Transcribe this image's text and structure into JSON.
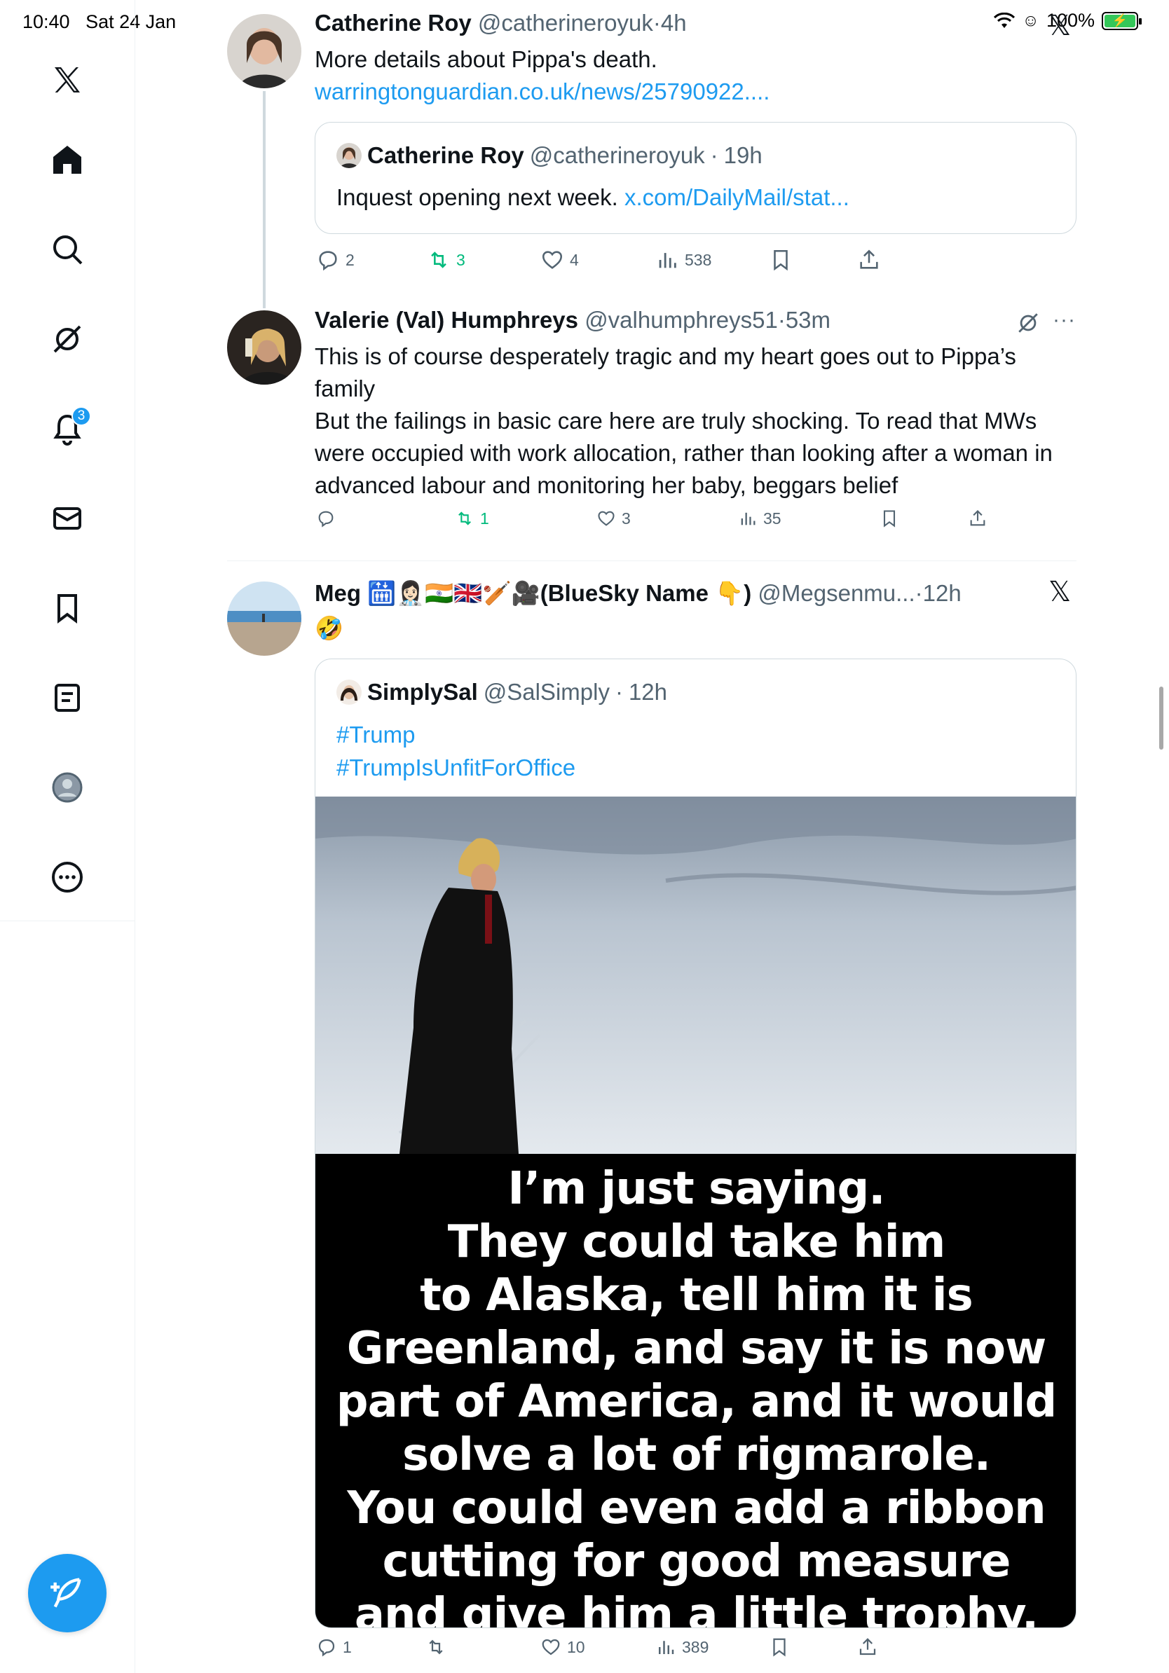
{
  "status_bar": {
    "time": "10:40",
    "date": "Sat 24 Jan",
    "battery": "100%"
  },
  "sidebar": {
    "items": [
      {
        "name": "home",
        "icon": "home-icon"
      },
      {
        "name": "explore",
        "icon": "search-icon"
      },
      {
        "name": "grok",
        "icon": "grok-icon"
      },
      {
        "name": "notifications",
        "icon": "bell-icon",
        "badge": "3"
      },
      {
        "name": "messages",
        "icon": "envelope-icon"
      },
      {
        "name": "bookmarks",
        "icon": "bookmark-icon"
      },
      {
        "name": "lists",
        "icon": "list-icon"
      },
      {
        "name": "profile",
        "icon": "profile-icon"
      },
      {
        "name": "more",
        "icon": "more-icon"
      }
    ],
    "compose_icon": "compose-post-icon"
  },
  "posts": [
    {
      "name": "Catherine Roy",
      "handle": "@catherineroyuk",
      "time": "4h",
      "text": "More details about Pippa's death.",
      "link": "warringtonguardian.co.uk/news/25790922....",
      "quote": {
        "name": "Catherine Roy",
        "handle": "@catherineroyuk",
        "time": "19h",
        "text": "Inquest opening next week.",
        "link": "x.com/DailyMail/stat..."
      },
      "stats": {
        "replies": "2",
        "reposts": "3",
        "likes": "4",
        "views": "538"
      }
    },
    {
      "name": "Valerie (Val) Humphreys",
      "handle": "@valhumphreys51",
      "time": "53m",
      "text1": "This is of course desperately tragic and my heart goes out to Pippa’s family",
      "text2": "But the failings in basic care here are truly shocking. To read that MWs were occupied with work allocation, rather than looking after a woman in advanced labour and monitoring her baby, beggars belief",
      "stats": {
        "replies": "",
        "reposts": "1",
        "likes": "3",
        "views": "35"
      }
    },
    {
      "name": "Meg 🛗👩🏻‍⚕️🇮🇳🇬🇧🏏🎥(BlueSky Name 👇)",
      "handle": "@Megsenmu...",
      "time": "12h",
      "text": "🤣",
      "quote": {
        "name": "SimplySal",
        "handle": "@SalSimply",
        "time": "12h",
        "hashtag1": "#Trump",
        "hashtag2": "#TrumpIsUnfitForOffice",
        "image_caption_lines": [
          "I’m just saying.",
          "They could take him",
          "to Alaska, tell him it is",
          "Greenland, and say it is now",
          "part of America, and it would",
          "solve a lot of rigmarole.",
          "You could even add a ribbon",
          "cutting for good measure",
          "and give him a little trophy."
        ]
      },
      "stats": {
        "replies": "1",
        "reposts": "",
        "likes": "10",
        "views": "389"
      }
    }
  ],
  "colors": {
    "accent": "#1d9bf0",
    "repost": "#00ba7c",
    "secondary_text": "#536471",
    "border": "#cfd9de"
  }
}
